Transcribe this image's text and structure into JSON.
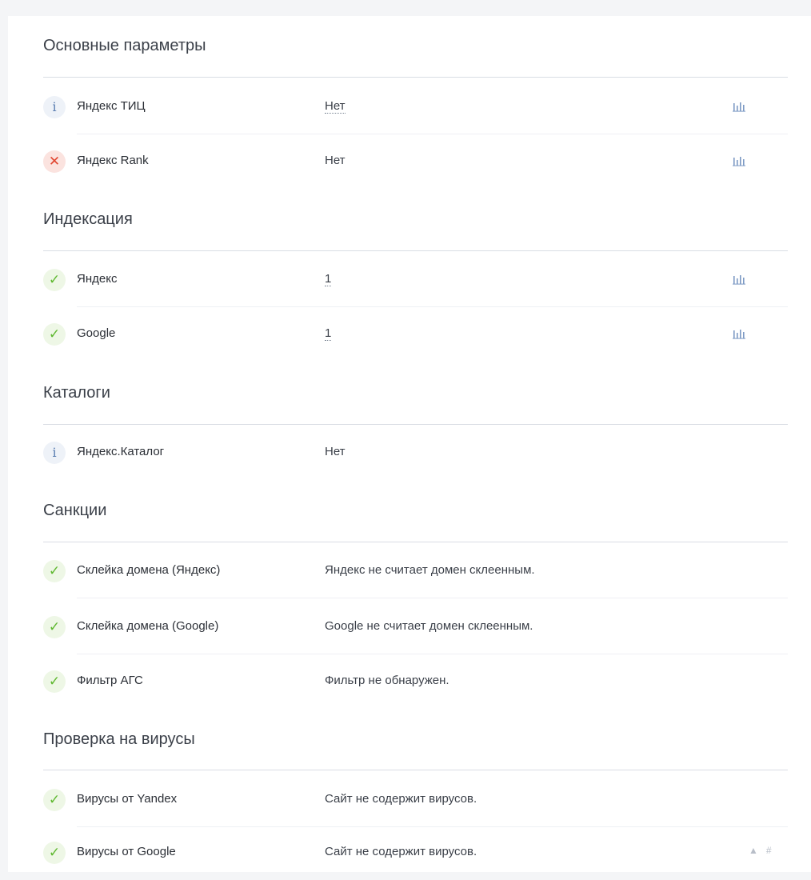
{
  "sections": [
    {
      "title": "Основные параметры",
      "rows": [
        {
          "status": "info",
          "label": "Яндекс ТИЦ",
          "value": "Нет",
          "value_link": true,
          "chart": true
        },
        {
          "status": "error",
          "label": "Яндекс Rank",
          "value": "Нет",
          "value_link": false,
          "chart": true
        }
      ]
    },
    {
      "title": "Индексация",
      "rows": [
        {
          "status": "ok",
          "label": "Яндекс",
          "value": "1",
          "value_link": true,
          "chart": true
        },
        {
          "status": "ok",
          "label": "Google",
          "value": "1",
          "value_link": true,
          "chart": true
        }
      ]
    },
    {
      "title": "Каталоги",
      "rows": [
        {
          "status": "info",
          "label": "Яндекс.Каталог",
          "value": "Нет",
          "value_link": false,
          "chart": false
        }
      ]
    },
    {
      "title": "Санкции",
      "rows": [
        {
          "status": "ok",
          "label": "Склейка домена (Яндекс)",
          "value": "Яндекс не считает домен склеенным.",
          "value_link": false,
          "chart": false
        },
        {
          "status": "ok",
          "label": "Склейка домена (Google)",
          "value": "Google не считает домен склеенным.",
          "value_link": false,
          "chart": false
        },
        {
          "status": "ok",
          "label": "Фильтр АГС",
          "value": "Фильтр не обнаружен.",
          "value_link": false,
          "chart": false
        }
      ]
    },
    {
      "title": "Проверка на вирусы",
      "rows": [
        {
          "status": "ok",
          "label": "Вирусы от Yandex",
          "value": "Сайт не содержит вирусов.",
          "value_link": false,
          "chart": false
        },
        {
          "status": "ok",
          "label": "Вирусы от Google",
          "value": "Сайт не содержит вирусов.",
          "value_link": false,
          "chart": false
        }
      ]
    }
  ],
  "icons": {
    "info": "info-icon",
    "ok": "check-icon",
    "error": "cross-icon",
    "chart": "bar-chart-icon",
    "scroll_up": "caret-up-icon",
    "anchor": "hash-icon"
  },
  "tools": {
    "up": "▲",
    "anchor": "#"
  },
  "colors": {
    "ok": "#5fb830",
    "error": "#e0452f",
    "info": "#5b7fb2",
    "chart_icon": "#7d9ac4"
  }
}
